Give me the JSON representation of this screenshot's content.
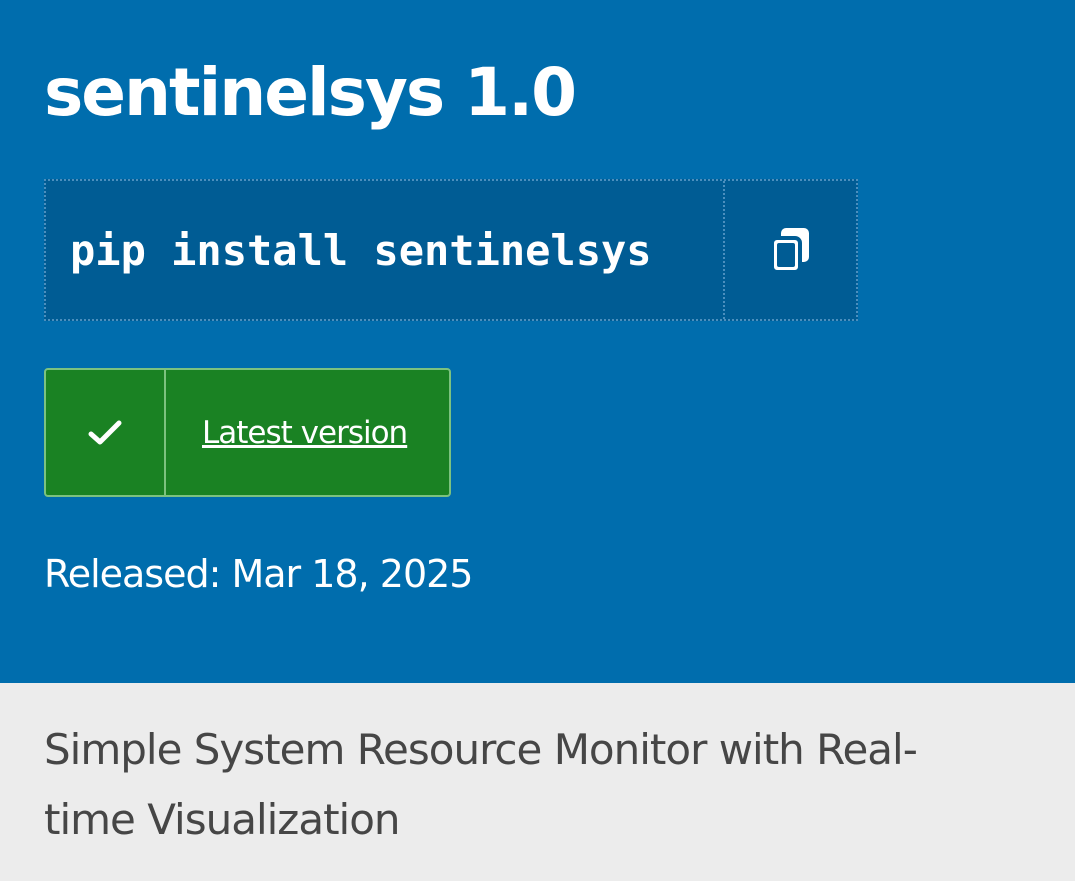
{
  "package": {
    "title": "sentinelsys 1.0",
    "install_command": "pip install sentinelsys",
    "copy_icon": "copy-icon",
    "version_badge": {
      "icon": "checkmark-icon",
      "label": "Latest version",
      "color": "#1a8223"
    },
    "released": "Released: Mar 18, 2025",
    "summary": "Simple System Resource Monitor with Real-time Visualization"
  },
  "colors": {
    "banner": "#006dad",
    "command_box": "#005c94",
    "summary_background": "#ececec"
  }
}
